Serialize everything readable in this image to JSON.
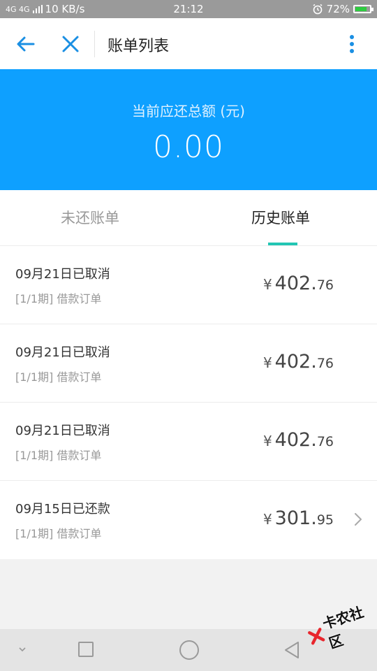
{
  "status_bar": {
    "network": "4G 4G",
    "speed": "10 KB/s",
    "time": "21:12",
    "alarm_icon": "alarm-clock-icon",
    "battery": "72%"
  },
  "header": {
    "back_icon": "arrow-left-icon",
    "close_icon": "close-icon",
    "title": "账单列表",
    "more_icon": "more-vertical-icon"
  },
  "summary": {
    "label": "当前应还总额 (元)",
    "amount": "0.00"
  },
  "tabs": [
    {
      "label": "未还账单",
      "active": false
    },
    {
      "label": "历史账单",
      "active": true
    }
  ],
  "bills": [
    {
      "status": "09月21日已取消",
      "desc": "[1/1期] 借款订单",
      "currency": "¥",
      "amount_int": "402",
      "amount_dec": "76",
      "has_chevron": false
    },
    {
      "status": "09月21日已取消",
      "desc": "[1/1期] 借款订单",
      "currency": "¥",
      "amount_int": "402",
      "amount_dec": "76",
      "has_chevron": false
    },
    {
      "status": "09月21日已取消",
      "desc": "[1/1期] 借款订单",
      "currency": "¥",
      "amount_int": "402",
      "amount_dec": "76",
      "has_chevron": false
    },
    {
      "status": "09月15日已还款",
      "desc": "[1/1期] 借款订单",
      "currency": "¥",
      "amount_int": "301",
      "amount_dec": "95",
      "has_chevron": true
    }
  ],
  "watermark": {
    "text": "卡农社区"
  },
  "colors": {
    "primary": "#0ea0ff",
    "tab_indicator": "#22c6b4",
    "icon_blue": "#1a8fe3"
  }
}
